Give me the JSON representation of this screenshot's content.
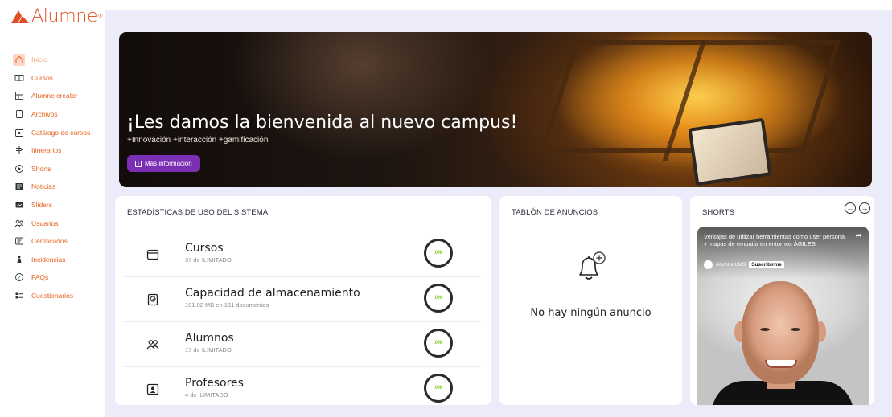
{
  "brand": {
    "name": "Alumne",
    "accent": "#e14d24",
    "reg": "®"
  },
  "sidebar": {
    "items": [
      {
        "label": "Inicio",
        "icon": "home-icon",
        "active": true
      },
      {
        "label": "Cursos",
        "icon": "book-icon"
      },
      {
        "label": "Alumne creator",
        "icon": "layout-icon"
      },
      {
        "label": "Archivos",
        "icon": "file-icon"
      },
      {
        "label": "Catálogo de cursos",
        "icon": "catalog-icon"
      },
      {
        "label": "Itinerarios",
        "icon": "signpost-icon"
      },
      {
        "label": "Shorts",
        "icon": "shorts-icon"
      },
      {
        "label": "Noticias",
        "icon": "news-icon"
      },
      {
        "label": "Sliders",
        "icon": "slider-icon"
      },
      {
        "label": "Usuarios",
        "icon": "users-icon"
      },
      {
        "label": "Certificados",
        "icon": "certificate-icon"
      },
      {
        "label": "Incidencias",
        "icon": "incident-icon"
      },
      {
        "label": "FAQs",
        "icon": "help-icon"
      },
      {
        "label": "Cuestionarios",
        "icon": "quiz-icon"
      }
    ]
  },
  "hero": {
    "title": "¡Les damos la bienvenida al nuevo campus!",
    "subtitle": "+Innovación +interacción +gamificación",
    "button_label": "Más información"
  },
  "stats": {
    "title": "ESTADÍSTICAS DE USO DEL SISTEMA",
    "rows": [
      {
        "name": "Cursos",
        "detail": "37 de ILIMITADO",
        "percent": "0%",
        "icon": "courses-icon"
      },
      {
        "name": "Capacidad de almacenamiento",
        "detail": "101.02 MB en 161 documentos",
        "percent": "0%",
        "icon": "storage-icon"
      },
      {
        "name": "Alumnos",
        "detail": "17 de ILIMITADO",
        "percent": "0%",
        "icon": "students-icon"
      },
      {
        "name": "Profesores",
        "detail": "4 de ILIMITADO",
        "percent": "0%",
        "icon": "teacher-icon"
      }
    ]
  },
  "announcements": {
    "title": "TABLÓN DE ANUNCIOS",
    "empty_text": "No hay ningún anuncio"
  },
  "shorts": {
    "title": "SHORTS",
    "video": {
      "title": "Ventajas de utilizar herramientas como user persona y mapas de empatía en entornos ÁGILES",
      "channel": "Alumne LMS",
      "subscribe_label": "Suscribirme"
    }
  }
}
